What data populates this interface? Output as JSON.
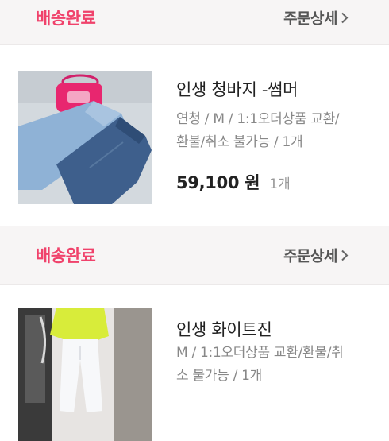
{
  "orders": [
    {
      "status": "배송완료",
      "detail_label": "주문상세",
      "product_name": "인생 청바지 -썸머",
      "option": "연청 / M / 1:1오더상품 교환/환불/취소 불가능 / 1개",
      "option_lines": [
        "연청 / M / 1:1오더상품 교환/",
        "환불/취소 불가능 / 1개"
      ],
      "price": "59,100 원",
      "qty": "1개",
      "thumb_icon": "denim-jeans-photo"
    },
    {
      "status": "배송완료",
      "detail_label": "주문상세",
      "product_name": "인생 화이트진",
      "option": "M / 1:1오더상품 교환/환불/취소 불가능 / 1개",
      "option_lines": [
        "M / 1:1오더상품 교환/환불/취",
        "소 불가능 / 1개"
      ],
      "thumb_icon": "white-jeans-photo"
    }
  ],
  "colors": {
    "status": "#f0426b",
    "header_bg": "#f7f5f5",
    "muted": "#888888"
  }
}
